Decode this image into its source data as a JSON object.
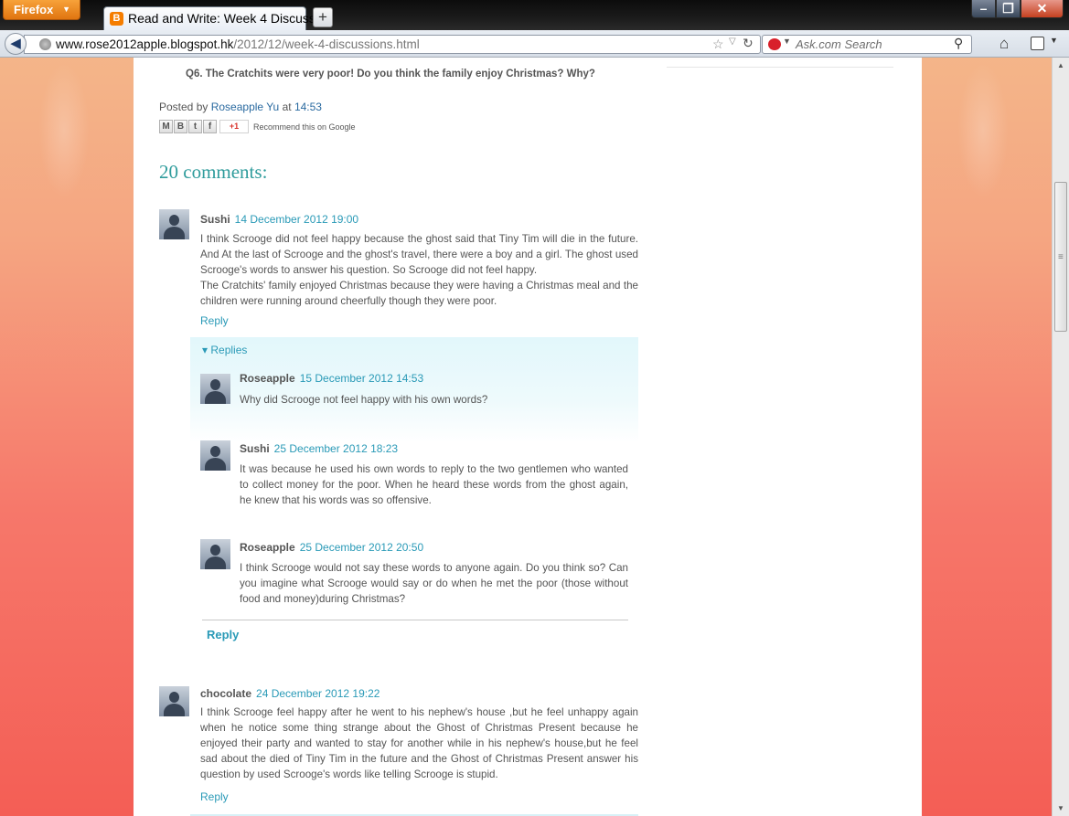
{
  "browser": {
    "firefox_button": "Firefox",
    "tab_title": "Read and Write: Week 4 Discuss...",
    "new_tab": "+",
    "url_domain": "www.rose2012apple.blogspot.hk",
    "url_path": "/2012/12/week-4-discussions.html",
    "search_placeholder": "Ask.com Search"
  },
  "post": {
    "question": "Q6. The Cratchits were very poor! Do you think the family enjoy Christmas? Why?",
    "posted_by_label": "Posted by",
    "author": "Roseapple Yu",
    "at_label": "at",
    "time": "14:53",
    "share_recommend": "Recommend this on Google",
    "gplus_label": "+1"
  },
  "comments_header": "20 comments:",
  "comments": [
    {
      "author": "Sushi",
      "date": "14 December 2012 19:00",
      "lines": [
        "I think Scrooge did not feel happy because the ghost said that Tiny Tim will die in the future. And At the last of Scrooge and the ghost's travel, there were a boy and a girl. The ghost used Scrooge's words to answer his question. So Scrooge did not feel happy.",
        "The Cratchits' family enjoyed Christmas because they were having a Christmas meal and the children were running around cheerfully though they were poor."
      ],
      "reply": "Reply"
    },
    {
      "author": "chocolate",
      "date": "24 December 2012 19:22",
      "lines": [
        "I think Scrooge feel happy after he went to his nephew's house ,but he feel unhappy again when he notice some thing strange about the Ghost of Christmas Present because he enjoyed their party and wanted to stay for another while in his nephew's house,but he feel sad about the died of Tiny Tim in the future and the Ghost of Christmas Present answer his question by used Scrooge's words like telling Scrooge is stupid."
      ],
      "reply": "Reply"
    }
  ],
  "replies_toggle": "Replies",
  "replies": [
    {
      "author": "Roseapple",
      "date": "15 December 2012 14:53",
      "text": "Why did Scrooge not feel happy with his own words?"
    },
    {
      "author": "Sushi",
      "date": "25 December 2012 18:23",
      "text": "It was because he used his own words to reply to the two gentlemen who wanted to collect money for the poor. When he heard these words from the ghost again, he knew that his words was so offensive."
    },
    {
      "author": "Roseapple",
      "date": "25 December 2012 20:50",
      "text": "I think Scrooge would not say these words to anyone again. Do you think so? Can you imagine what Scrooge would say or do when he met the poor (those without food and money)during Christmas?"
    }
  ],
  "reply_thread_button": "Reply",
  "colors": {
    "link": "#2a9ab7",
    "heading": "#2f9c9c",
    "page_bg_top": "#f4b589",
    "page_bg_bottom": "#f45e55"
  }
}
